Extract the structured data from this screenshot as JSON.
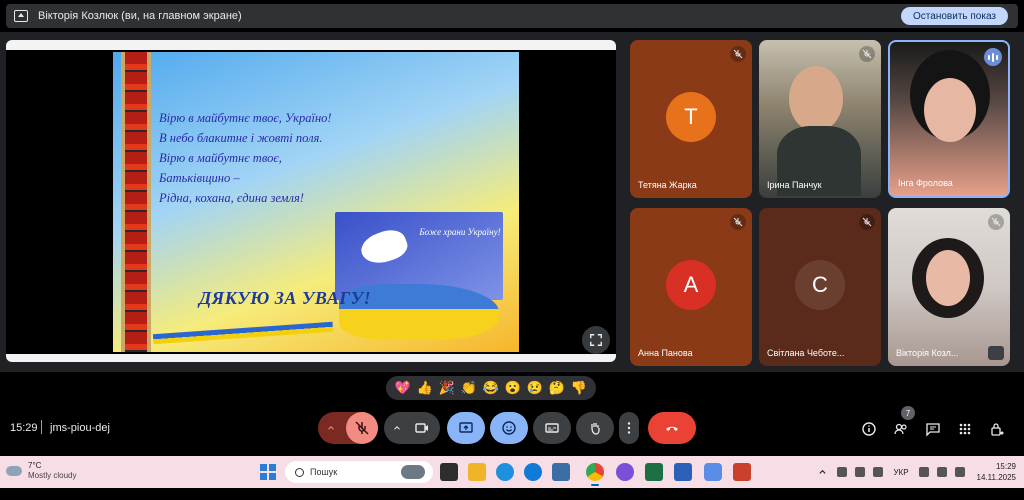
{
  "banner": {
    "text": "Вікторія Козлюк (ви, на главном экране)",
    "stop_label": "Остановить показ"
  },
  "shared_slide": {
    "poem": [
      "Вірю в майбутнє твоє, Україно!",
      "В небо блакитне і жовті поля.",
      "Вірю в майбутнє  твоє,",
      "Батьківщино –",
      "Рідна, кохана, єдина земля!"
    ],
    "blessing": "Боже храни Україну!",
    "thanks": "ДЯКУЮ ЗА УВАГУ!"
  },
  "participants": [
    {
      "name": "Тетяна Жарка",
      "initial": "Т",
      "avatar_color": "#e8711c",
      "muted": true
    },
    {
      "name": "Ірина Панчук",
      "muted": true
    },
    {
      "name": "Інга Фролова",
      "muted": false,
      "speaking": true
    },
    {
      "name": "Анна Панова",
      "initial": "А",
      "avatar_color": "#d93025",
      "muted": true
    },
    {
      "name": "Світлана Чеботе...",
      "initial": "С",
      "avatar_color": "#5f3a2e",
      "muted": true
    },
    {
      "name": "Вікторія Козл...",
      "muted": true
    }
  ],
  "reactions": [
    "💖",
    "👍",
    "🎉",
    "👏",
    "😂",
    "😮",
    "😢",
    "🤔",
    "👎"
  ],
  "meeting": {
    "time": "15:29",
    "code": "jms-piou-dej",
    "people_count": "7"
  },
  "taskbar": {
    "temperature": "7°C",
    "weather": "Mostly cloudy",
    "search_placeholder": "Пошук",
    "language": "УКР",
    "clock_time": "15:29",
    "clock_date": "14.11.2025"
  },
  "colors": {
    "accent": "#8ab4f8",
    "end_call": "#ea4335",
    "mic_off": "#f28b82",
    "taskbar_bg": "#f7dde6"
  }
}
